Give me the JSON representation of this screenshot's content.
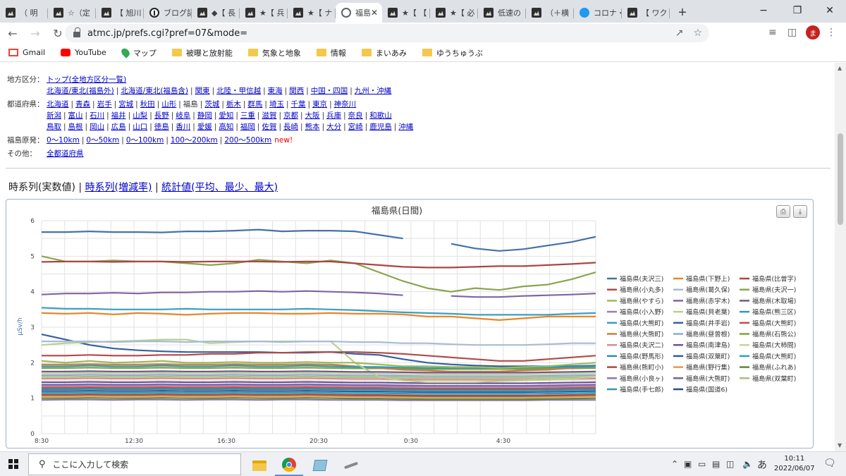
{
  "browser": {
    "tabs": [
      {
        "title": "（ 明",
        "icon": "hatena-icon"
      },
      {
        "title": "☆（定",
        "icon": "hatena-icon"
      },
      {
        "title": "【 旭川",
        "icon": "hatena-icon"
      },
      {
        "title": "ブログ記",
        "icon": "info-icon"
      },
      {
        "title": "◆【 長",
        "icon": "hatena-icon"
      },
      {
        "title": "★【 兵",
        "icon": "hatena-icon"
      },
      {
        "title": "★【 ナ",
        "icon": "hatena-icon"
      },
      {
        "title": "福島",
        "icon": "globe-icon",
        "active": true
      },
      {
        "title": "★【 【",
        "icon": "hatena-icon"
      },
      {
        "title": "★【 必",
        "icon": "hatena-icon"
      },
      {
        "title": "低速の",
        "icon": "hatena-icon"
      },
      {
        "title": "（＋横",
        "icon": "hatena-icon"
      },
      {
        "title": "コロナ・",
        "icon": "twitter-icon"
      },
      {
        "title": "【 ワク",
        "icon": "hatena-icon"
      }
    ],
    "new_tab": "+",
    "url": "atmc.jp/prefs.cgi?pref=07&mode=",
    "profile_initial": "ま",
    "bookmarks": [
      {
        "label": "Gmail",
        "icon": "gmail-icon"
      },
      {
        "label": "YouTube",
        "icon": "youtube-icon"
      },
      {
        "label": "マップ",
        "icon": "maps-icon"
      },
      {
        "label": "被曝と放射能",
        "icon": "folder-icon"
      },
      {
        "label": "気象と地象",
        "icon": "folder-icon"
      },
      {
        "label": "情報",
        "icon": "folder-icon"
      },
      {
        "label": "まいあみ",
        "icon": "folder-icon"
      },
      {
        "label": "ゆうちゅうぶ",
        "icon": "folder-icon"
      }
    ]
  },
  "nav": {
    "region_label": "地方区分：",
    "region_top": "トップ(全地方区分一覧)",
    "regions": [
      "北海道/東北(福島外)",
      "北海道/東北(福島含)",
      "関東",
      "北陸・甲信越",
      "東海",
      "関西",
      "中国・四国",
      "九州・沖縄"
    ],
    "pref_label": "都道府県：",
    "prefs_row1": [
      "北海道",
      "青森",
      "岩手",
      "宮城",
      "秋田",
      "山形",
      "福島",
      "茨城",
      "栃木",
      "群馬",
      "埼玉",
      "千葉",
      "東京",
      "神奈川"
    ],
    "prefs_row2": [
      "新潟",
      "富山",
      "石川",
      "福井",
      "山梨",
      "長野",
      "岐阜",
      "静岡",
      "愛知",
      "三重",
      "滋賀",
      "京都",
      "大阪",
      "兵庫",
      "奈良",
      "和歌山"
    ],
    "prefs_row3": [
      "鳥取",
      "島根",
      "岡山",
      "広島",
      "山口",
      "徳島",
      "香川",
      "愛媛",
      "高知",
      "福岡",
      "佐賀",
      "長崎",
      "熊本",
      "大分",
      "宮崎",
      "鹿児島",
      "沖縄"
    ],
    "nuclear_label": "福島原発：",
    "nuclear": [
      "0〜10km",
      "0〜50km",
      "0〜100km",
      "100〜200km",
      "200〜500km"
    ],
    "new_badge": "new!",
    "other_label": "その他：",
    "other": "全都道府県"
  },
  "modes": {
    "current": "時系列(実数値)",
    "link1": "時系列(増減率)",
    "link2": "統計値(平均、最少、最大)",
    "sep": "|"
  },
  "chart_data": {
    "type": "line",
    "title": "福島県(日間)",
    "ylabel": "μSv/h",
    "ylim": [
      0,
      6
    ],
    "yticks": [
      "0",
      "1",
      "2",
      "3",
      "4",
      "5",
      "6"
    ],
    "xticks": [
      "8:30",
      "12:30",
      "16:30",
      "20:30",
      "0:30",
      "4:30"
    ],
    "x_range": [
      0,
      23
    ],
    "x_start": "8:30",
    "grid": true,
    "legend_position": "right",
    "series": [
      {
        "name": "福島県(夫沢三)",
        "color": "#4572a7",
        "values": [
          5.68,
          5.68,
          5.7,
          5.68,
          5.68,
          5.67,
          5.7,
          5.7,
          5.72,
          5.75,
          5.7,
          5.72,
          5.72,
          5.7,
          5.6,
          5.5,
          null,
          5.35,
          5.22,
          5.15,
          5.2,
          5.3,
          5.4,
          5.55
        ]
      },
      {
        "name": "福島県(下野上)",
        "color": "#e8862a",
        "values": [
          3.4,
          3.38,
          3.4,
          3.36,
          3.4,
          3.38,
          3.35,
          3.38,
          3.4,
          3.4,
          3.38,
          3.38,
          3.4,
          3.38,
          3.38,
          3.36,
          3.3,
          3.3,
          3.25,
          3.2,
          3.25,
          3.3,
          3.3,
          3.3
        ]
      },
      {
        "name": "福島県(比曽字)",
        "color": "#aa4643",
        "values": [
          4.84,
          4.85,
          4.85,
          4.84,
          4.85,
          4.85,
          4.84,
          4.85,
          4.85,
          4.85,
          4.84,
          4.85,
          4.85,
          4.8,
          4.75,
          4.7,
          4.68,
          4.68,
          4.7,
          4.72,
          4.72,
          4.75,
          4.78,
          4.82
        ]
      },
      {
        "name": "福島県(小丸多)",
        "color": "#b14a46",
        "values": [
          2.2,
          2.2,
          2.22,
          2.2,
          2.2,
          2.22,
          2.22,
          2.25,
          2.25,
          2.28,
          2.28,
          2.3,
          2.3,
          2.3,
          2.28,
          2.25,
          2.2,
          2.15,
          2.1,
          2.05,
          2.05,
          2.1,
          2.15,
          2.2
        ]
      },
      {
        "name": "福島県(葛久保)",
        "color": "#a7bcd7",
        "values": [
          2.6,
          2.6,
          2.6,
          2.58,
          2.6,
          2.6,
          2.58,
          2.6,
          2.6,
          2.6,
          2.58,
          2.6,
          2.6,
          2.58,
          2.58,
          2.55,
          2.55,
          2.52,
          2.5,
          2.5,
          2.5,
          2.52,
          2.55,
          2.55
        ]
      },
      {
        "name": "福島県(夫沢一)",
        "color": "#89a54e",
        "values": [
          5.0,
          4.85,
          4.85,
          4.88,
          4.85,
          4.85,
          4.8,
          4.75,
          4.8,
          4.9,
          4.85,
          4.8,
          4.88,
          4.8,
          4.55,
          4.3,
          4.1,
          4.0,
          4.1,
          4.05,
          4.15,
          4.2,
          4.35,
          4.55
        ]
      },
      {
        "name": "福島県(やすら)",
        "color": "#9bbb59",
        "values": [
          2.05,
          2.0,
          2.05,
          2.0,
          2.02,
          2.05,
          2.0,
          2.0,
          2.02,
          2.0,
          2.0,
          2.02,
          2.0,
          2.0,
          1.95,
          1.9,
          1.9,
          1.88,
          1.88,
          1.85,
          1.88,
          1.9,
          1.95,
          2.0
        ]
      },
      {
        "name": "福島県(赤宇木)",
        "color": "#8064a2",
        "values": [
          3.92,
          3.95,
          3.95,
          3.97,
          3.95,
          3.98,
          3.98,
          4.0,
          4.0,
          4.02,
          4.0,
          4.02,
          4.0,
          3.98,
          3.95,
          3.9,
          null,
          3.88,
          3.85,
          3.85,
          3.88,
          3.9,
          3.92,
          3.95
        ]
      },
      {
        "name": "福島県(木取場)",
        "color": "#71588f",
        "values": [
          1.75,
          1.75,
          1.76,
          1.75,
          1.75,
          1.76,
          1.75,
          1.75,
          1.76,
          1.75,
          1.75,
          1.76,
          1.75,
          1.74,
          1.74,
          1.73,
          1.72,
          1.72,
          1.72,
          1.72,
          1.72,
          1.73,
          1.74,
          1.75
        ]
      },
      {
        "name": "福島県(小入野)",
        "color": "#9980b8",
        "values": [
          1.35,
          1.35,
          1.36,
          1.35,
          1.35,
          1.36,
          1.35,
          1.35,
          1.36,
          1.35,
          1.35,
          1.36,
          1.35,
          1.34,
          1.34,
          1.33,
          1.32,
          1.32,
          1.32,
          1.32,
          1.32,
          1.33,
          1.34,
          1.35
        ]
      },
      {
        "name": "福島県(貝老葉)",
        "color": "#b9cf8e",
        "values": [
          2.5,
          2.55,
          2.58,
          2.6,
          2.62,
          2.65,
          2.65,
          2.55,
          2.58,
          2.6,
          2.6,
          2.6,
          2.6,
          2.0,
          1.6,
          1.5,
          1.45,
          1.45,
          1.45,
          1.48,
          1.5,
          1.52,
          1.55,
          1.6
        ]
      },
      {
        "name": "福島県(熊三区)",
        "color": "#2d9cb8",
        "values": [
          1.9,
          1.9,
          1.92,
          1.9,
          1.9,
          1.92,
          1.9,
          1.9,
          1.92,
          1.9,
          1.9,
          1.92,
          1.9,
          1.88,
          1.88,
          1.86,
          1.85,
          1.85,
          1.85,
          1.85,
          1.86,
          1.87,
          1.88,
          1.9
        ]
      },
      {
        "name": "福島県(大熊町)",
        "color": "#3a9ec2",
        "values": [
          3.55,
          3.52,
          3.52,
          3.5,
          3.5,
          3.5,
          3.52,
          3.5,
          3.5,
          3.5,
          3.5,
          3.52,
          3.5,
          3.48,
          3.45,
          3.42,
          3.4,
          3.38,
          3.35,
          3.35,
          3.35,
          3.35,
          3.38,
          3.4
        ]
      },
      {
        "name": "福島県(井手岩)",
        "color": "#3560a0",
        "values": [
          2.8,
          2.65,
          2.5,
          2.4,
          2.35,
          2.32,
          2.3,
          2.3,
          2.3,
          2.3,
          2.28,
          2.28,
          2.3,
          2.25,
          2.22,
          2.1,
          2.0,
          1.95,
          1.92,
          1.9,
          1.9,
          1.9,
          1.9,
          1.92
        ]
      },
      {
        "name": "福島県(大熊町)",
        "color": "#c24e4a",
        "values": [
          1.3,
          1.3,
          1.31,
          1.3,
          1.3,
          1.31,
          1.3,
          1.3,
          1.31,
          1.3,
          1.3,
          1.31,
          1.3,
          1.29,
          1.29,
          1.28,
          1.27,
          1.27,
          1.27,
          1.27,
          1.27,
          1.28,
          1.29,
          1.3
        ]
      },
      {
        "name": "福島県(大熊町)",
        "color": "#d27a3a",
        "values": [
          1.95,
          1.95,
          1.96,
          1.95,
          1.95,
          1.96,
          1.95,
          1.95,
          1.96,
          1.95,
          1.95,
          1.96,
          1.95,
          1.9,
          1.85,
          1.8,
          1.78,
          1.75,
          1.75,
          1.75,
          1.78,
          1.8,
          1.85,
          1.9
        ]
      },
      {
        "name": "福島県(昼曽根)",
        "color": "#8ea9d0",
        "values": [
          1.65,
          1.65,
          1.66,
          1.65,
          1.65,
          1.66,
          1.65,
          1.65,
          1.66,
          1.65,
          1.65,
          1.66,
          1.65,
          1.64,
          1.64,
          1.63,
          1.62,
          1.62,
          1.62,
          1.62,
          1.62,
          1.63,
          1.64,
          1.65
        ]
      },
      {
        "name": "福島県(石熊公)",
        "color": "#7fa23f",
        "values": [
          1.85,
          1.85,
          1.86,
          1.85,
          1.85,
          1.86,
          1.85,
          1.85,
          1.86,
          1.85,
          1.85,
          1.86,
          1.85,
          1.84,
          1.84,
          1.83,
          1.82,
          1.82,
          1.82,
          1.82,
          1.82,
          1.83,
          1.84,
          1.85
        ]
      },
      {
        "name": "福島県(夫沢二)",
        "color": "#d98c8a",
        "values": [
          1.55,
          1.55,
          1.56,
          1.55,
          1.55,
          1.56,
          1.55,
          1.55,
          1.56,
          1.55,
          1.55,
          1.56,
          1.55,
          1.54,
          1.54,
          1.53,
          1.52,
          1.52,
          1.52,
          1.52,
          1.52,
          1.53,
          1.54,
          1.55
        ]
      },
      {
        "name": "福島県(南津島)",
        "color": "#6a5396",
        "values": [
          1.45,
          1.45,
          1.46,
          1.45,
          1.45,
          1.46,
          1.45,
          1.45,
          1.46,
          1.45,
          1.45,
          1.46,
          1.45,
          1.44,
          1.44,
          1.43,
          1.42,
          1.42,
          1.42,
          1.42,
          1.42,
          1.43,
          1.44,
          1.45
        ]
      },
      {
        "name": "福島県(大柿間)",
        "color": "#c4d49e",
        "values": [
          1.7,
          1.7,
          1.71,
          1.7,
          1.7,
          1.71,
          1.7,
          1.7,
          1.71,
          1.7,
          1.7,
          1.71,
          1.7,
          1.69,
          1.69,
          1.68,
          1.67,
          1.67,
          1.67,
          1.67,
          1.67,
          1.68,
          1.69,
          1.7
        ]
      },
      {
        "name": "福島県(野馬形)",
        "color": "#2e8fa8",
        "values": [
          1.25,
          1.25,
          1.26,
          1.25,
          1.25,
          1.26,
          1.25,
          1.25,
          1.26,
          1.25,
          1.25,
          1.26,
          1.25,
          1.24,
          1.24,
          1.23,
          1.22,
          1.22,
          1.22,
          1.22,
          1.22,
          1.23,
          1.24,
          1.25
        ]
      },
      {
        "name": "福島県(双葉町)",
        "color": "#2f5d9a",
        "values": [
          1.2,
          1.2,
          1.21,
          1.2,
          1.2,
          1.21,
          1.2,
          1.2,
          1.21,
          1.2,
          1.2,
          1.21,
          1.2,
          1.19,
          1.19,
          1.18,
          1.17,
          1.17,
          1.17,
          1.17,
          1.17,
          1.18,
          1.19,
          1.2
        ]
      },
      {
        "name": "福島県(大熊町)",
        "color": "#2aa3b5",
        "values": [
          1.15,
          1.15,
          1.16,
          1.15,
          1.15,
          1.16,
          1.15,
          1.15,
          1.16,
          1.15,
          1.15,
          1.16,
          1.15,
          1.14,
          1.14,
          1.13,
          1.12,
          1.12,
          1.12,
          1.12,
          1.12,
          1.13,
          1.14,
          1.15
        ]
      },
      {
        "name": "福島県(熊町小)",
        "color": "#b34642",
        "values": [
          1.1,
          1.1,
          1.11,
          1.1,
          1.1,
          1.11,
          1.1,
          1.1,
          1.11,
          1.1,
          1.1,
          1.11,
          1.1,
          1.09,
          1.09,
          1.08,
          1.07,
          1.07,
          1.07,
          1.07,
          1.07,
          1.08,
          1.09,
          1.1
        ]
      },
      {
        "name": "福島県(野行集)",
        "color": "#e39a4f",
        "values": [
          1.05,
          1.05,
          1.06,
          1.05,
          1.05,
          1.06,
          1.05,
          1.05,
          1.06,
          1.05,
          1.05,
          1.06,
          1.05,
          1.04,
          1.04,
          1.03,
          1.02,
          1.02,
          1.02,
          1.02,
          1.02,
          1.03,
          1.04,
          1.05
        ]
      },
      {
        "name": "福島県(ふれあ)",
        "color": "#5e8a34",
        "values": [
          1.0,
          1.0,
          1.01,
          1.0,
          1.0,
          1.01,
          1.0,
          1.0,
          1.01,
          1.0,
          1.0,
          1.01,
          1.0,
          0.99,
          0.99,
          0.98,
          0.97,
          0.97,
          0.97,
          0.97,
          0.97,
          0.98,
          0.99,
          1.0
        ]
      },
      {
        "name": "福島県(小良ヶ)",
        "color": "#8e74b3",
        "values": [
          0.95,
          0.96,
          0.96,
          0.95,
          0.96,
          0.96,
          0.95,
          0.96,
          0.96,
          0.95,
          0.96,
          0.96,
          0.95,
          0.95,
          0.95,
          0.94,
          0.94,
          0.94,
          0.94,
          0.94,
          0.94,
          0.95,
          0.95,
          0.95
        ]
      },
      {
        "name": "福島県(大熊町)",
        "color": "#7a5f9e",
        "values": [
          1.38,
          1.38,
          1.39,
          1.38,
          1.38,
          1.39,
          1.38,
          1.38,
          1.39,
          1.38,
          1.38,
          1.39,
          1.38,
          1.37,
          1.37,
          1.36,
          1.35,
          1.35,
          1.35,
          1.35,
          1.35,
          1.36,
          1.37,
          1.38
        ]
      },
      {
        "name": "福島県(双葉町)",
        "color": "#a9c07a",
        "values": [
          1.6,
          1.6,
          1.61,
          1.6,
          1.6,
          1.61,
          1.6,
          1.6,
          1.61,
          1.6,
          1.6,
          1.61,
          1.6,
          1.59,
          1.59,
          1.58,
          1.57,
          1.57,
          1.57,
          1.57,
          1.57,
          1.58,
          1.59,
          1.6
        ]
      },
      {
        "name": "福島県(手七郎)",
        "color": "#3598a6",
        "values": [
          1.28,
          1.28,
          1.29,
          1.28,
          1.28,
          1.29,
          1.28,
          1.28,
          1.29,
          1.28,
          1.28,
          1.29,
          1.28,
          1.27,
          1.27,
          1.26,
          1.25,
          1.25,
          1.25,
          1.25,
          1.25,
          1.26,
          1.27,
          1.28
        ]
      },
      {
        "name": "福島県(国道6)",
        "color": "#24508c",
        "values": [
          1.08,
          1.08,
          1.09,
          1.08,
          1.08,
          1.09,
          1.08,
          1.08,
          1.09,
          1.08,
          1.08,
          1.09,
          1.08,
          1.07,
          1.07,
          1.06,
          1.05,
          1.05,
          1.05,
          1.05,
          1.05,
          1.06,
          1.07,
          1.08
        ]
      }
    ]
  },
  "taskbar": {
    "search_placeholder": "ここに入力して検索",
    "ime": "あ",
    "time": "10:11",
    "date": "2022/06/07"
  }
}
